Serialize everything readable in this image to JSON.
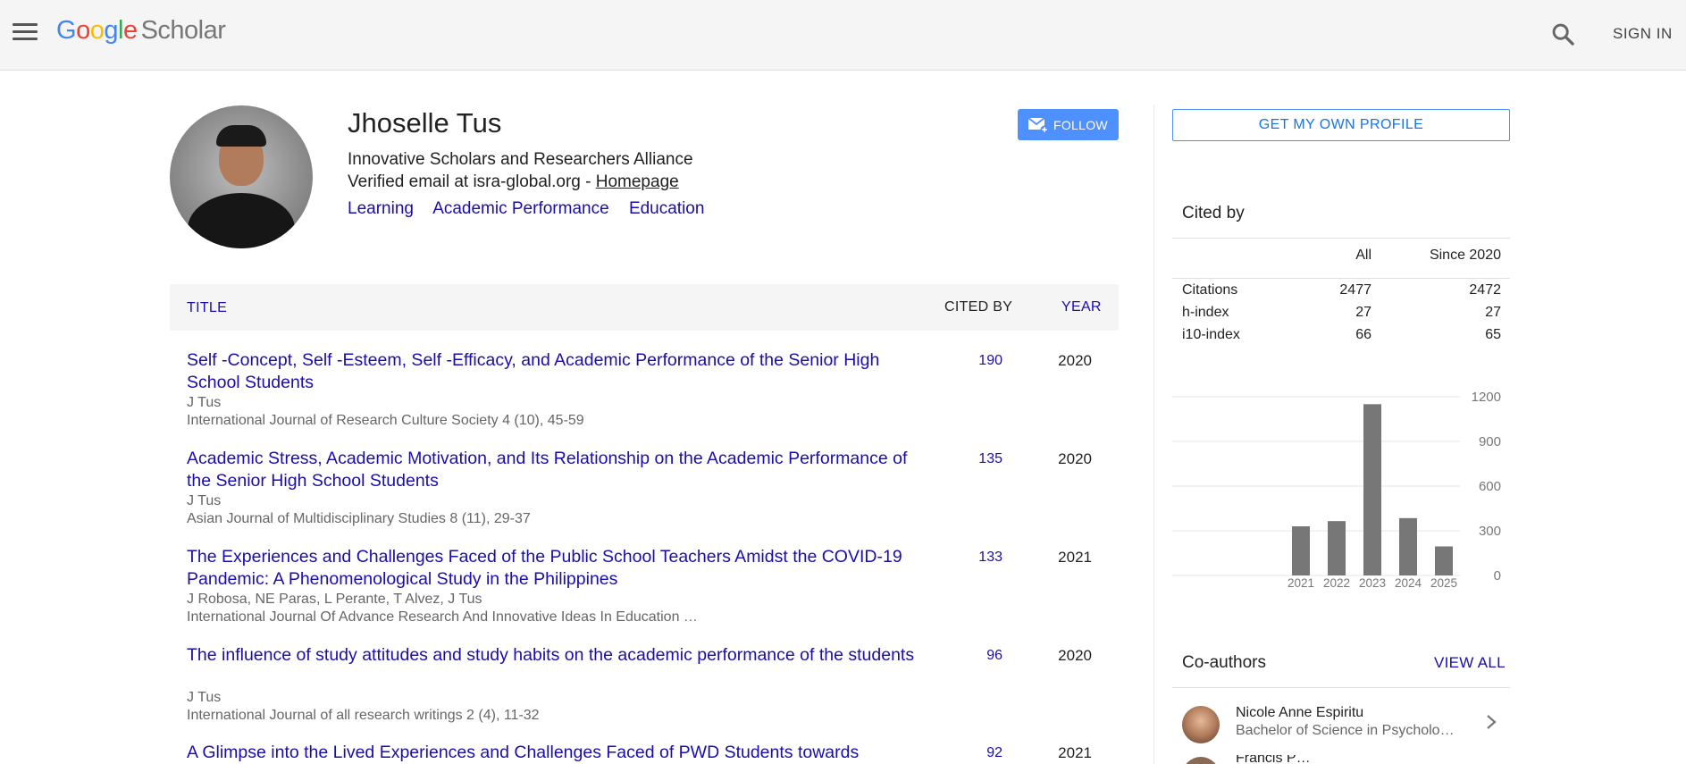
{
  "header": {
    "logo_google": "Google",
    "logo_scholar": "Scholar",
    "sign_in": "SIGN IN"
  },
  "profile": {
    "name": "Jhoselle Tus",
    "affiliation": "Innovative Scholars and Researchers Alliance",
    "email_text": "Verified email at isra-global.org - ",
    "homepage_label": "Homepage",
    "interests": [
      "Learning",
      "Academic Performance",
      "Education"
    ],
    "follow_label": "FOLLOW"
  },
  "table": {
    "col_title": "TITLE",
    "col_cited": "CITED BY",
    "col_year": "YEAR",
    "rows": [
      {
        "title": "Self -Concept, Self -Esteem, Self -Efficacy, and Academic Performance of the Senior High School Students",
        "authors": "J Tus",
        "venue": "International Journal of Research Culture Society 4 (10), 45-59",
        "cited": "190",
        "year": "2020"
      },
      {
        "title": "Academic Stress, Academic Motivation, and Its Relationship on the Academic Performance of the Senior High School Students",
        "authors": "J Tus",
        "venue": "Asian Journal of Multidisciplinary Studies 8 (11), 29-37",
        "cited": "135",
        "year": "2020"
      },
      {
        "title": "The Experiences and Challenges Faced of the Public School Teachers Amidst the COVID-19 Pandemic: A Phenomenological Study in the Philippines",
        "authors": "J Robosa, NE Paras, L Perante, T Alvez, J Tus",
        "venue": "International Journal Of Advance Research And Innovative Ideas In Education …",
        "cited": "133",
        "year": "2021"
      },
      {
        "title": "The influence of study attitudes and study habits on the academic performance of the students",
        "authors": "J Tus",
        "venue": "International Journal of all research writings 2 (4), 11-32",
        "cited": "96",
        "year": "2020"
      },
      {
        "title": "A Glimpse into the Lived Experiences and Challenges Faced of PWD Students towards",
        "authors": "",
        "venue": "",
        "cited": "92",
        "year": "2021"
      }
    ]
  },
  "sidebar": {
    "get_profile_label": "GET MY OWN PROFILE",
    "cited_by": {
      "title": "Cited by",
      "col_all": "All",
      "col_since": "Since 2020",
      "rows": [
        {
          "label": "Citations",
          "all": "2477",
          "since": "2472"
        },
        {
          "label": "h-index",
          "all": "27",
          "since": "27"
        },
        {
          "label": "i10-index",
          "all": "66",
          "since": "65"
        }
      ]
    },
    "coauthors": {
      "title": "Co-authors",
      "view_all": "VIEW ALL",
      "items": [
        {
          "name": "Nicole Anne Espiritu",
          "desc": "Bachelor of Science in Psycholo…"
        },
        {
          "name": "Francis P…",
          "desc": ""
        }
      ]
    }
  },
  "chart_data": {
    "type": "bar",
    "categories": [
      "2021",
      "2022",
      "2023",
      "2024",
      "2025"
    ],
    "values": [
      330,
      365,
      1150,
      385,
      195
    ],
    "ylim": [
      0,
      1200
    ],
    "yticks": [
      "0",
      "300",
      "600",
      "900",
      "1200"
    ],
    "grid": true,
    "bar_color": "#777777"
  }
}
